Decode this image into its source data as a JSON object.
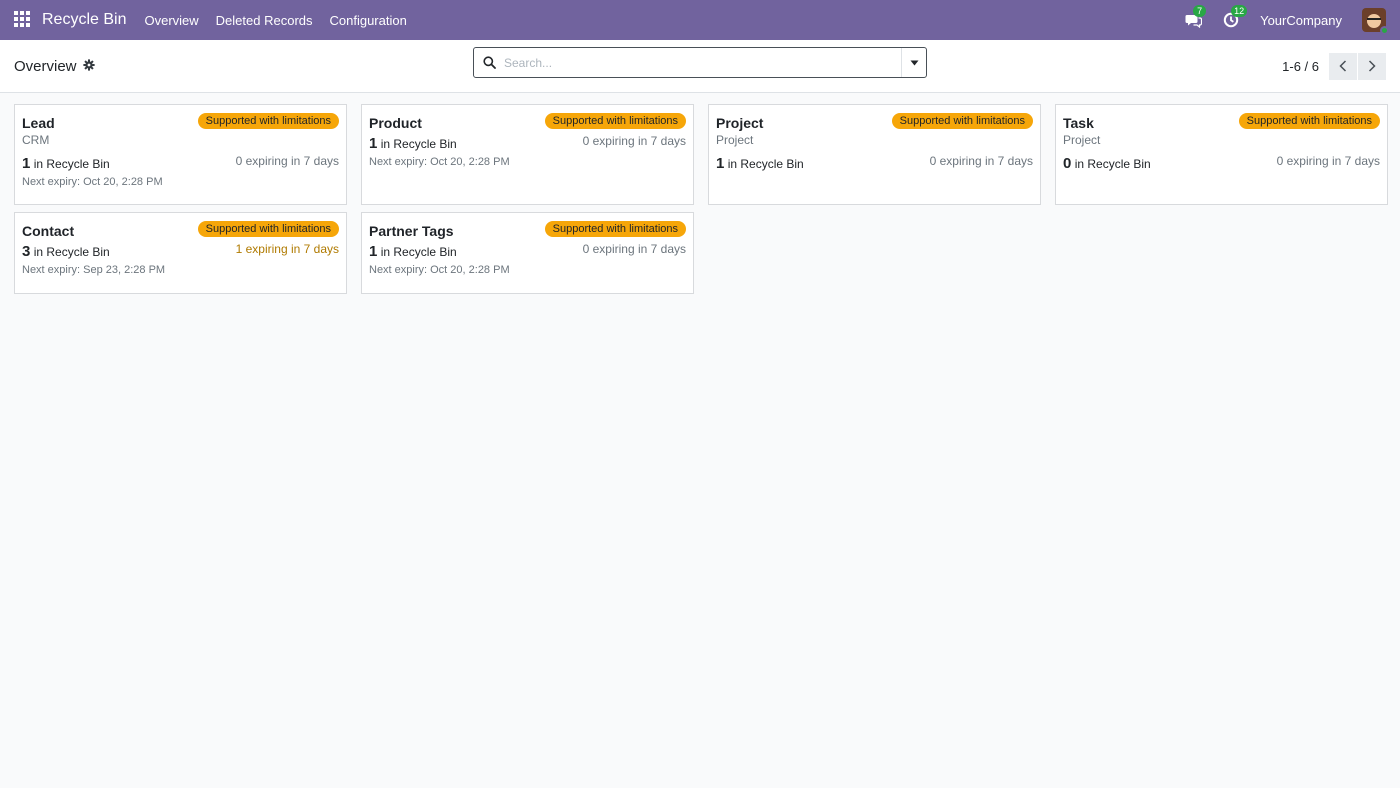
{
  "navbar": {
    "brand": "Recycle Bin",
    "menu": [
      "Overview",
      "Deleted Records",
      "Configuration"
    ],
    "messages_count": "7",
    "activities_count": "12",
    "company": "YourCompany",
    "bg_color": "#71639e"
  },
  "control_panel": {
    "breadcrumb": "Overview",
    "search_placeholder": "Search...",
    "pager": "1-6 / 6"
  },
  "badge_color": "#f6a609",
  "cards": [
    {
      "title": "Lead",
      "badge": "Supported with limitations",
      "subtitle": "CRM",
      "count": "1",
      "count_suffix": "in Recycle Bin",
      "expiring": "0 expiring in 7 days",
      "next_expiry": "Next expiry: Oct 20, 2:28 PM"
    },
    {
      "title": "Product",
      "badge": "Supported with limitations",
      "subtitle": "",
      "count": "1",
      "count_suffix": "in Recycle Bin",
      "expiring": "0 expiring in 7 days",
      "next_expiry": "Next expiry: Oct 20, 2:28 PM"
    },
    {
      "title": "Project",
      "badge": "Supported with limitations",
      "subtitle": "Project",
      "count": "1",
      "count_suffix": "in Recycle Bin",
      "expiring": "0 expiring in 7 days",
      "next_expiry": ""
    },
    {
      "title": "Task",
      "badge": "Supported with limitations",
      "subtitle": "Project",
      "count": "0",
      "count_suffix": "in Recycle Bin",
      "expiring": "0 expiring in 7 days",
      "next_expiry": ""
    },
    {
      "title": "Contact",
      "badge": "Supported with limitations",
      "subtitle": "",
      "count": "3",
      "count_suffix": "in Recycle Bin",
      "expiring": "1 expiring in 7 days",
      "next_expiry": "Next expiry: Sep 23, 2:28 PM"
    },
    {
      "title": "Partner Tags",
      "badge": "Supported with limitations",
      "subtitle": "",
      "count": "1",
      "count_suffix": "in Recycle Bin",
      "expiring": "0 expiring in 7 days",
      "next_expiry": "Next expiry: Oct 20, 2:28 PM"
    }
  ]
}
